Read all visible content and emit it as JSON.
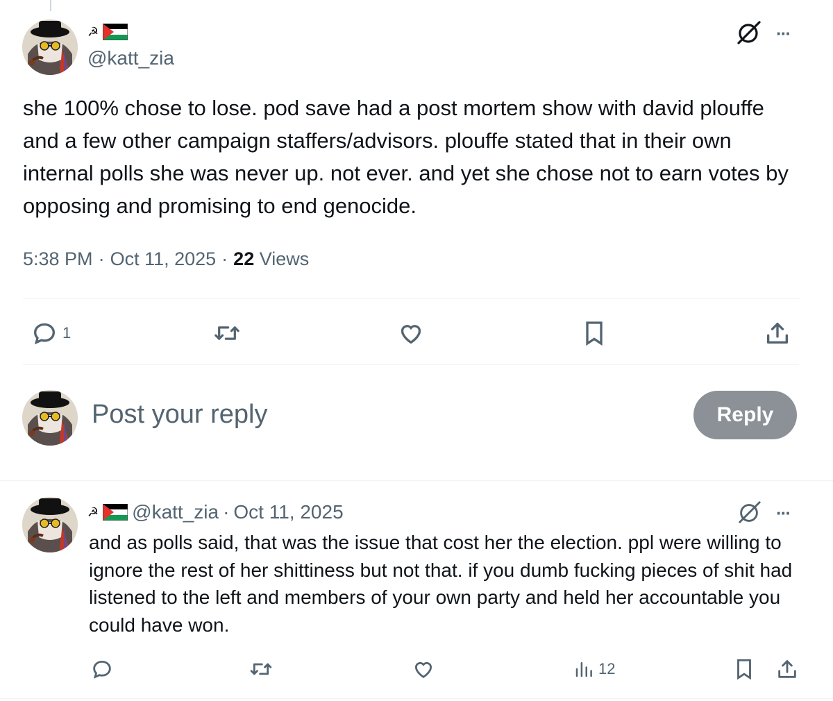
{
  "main_post": {
    "display_name_symbol": "☭",
    "handle": "@katt_zia",
    "text": "she 100% chose to lose. pod save had a post mortem show with david plouffe and a few other campaign staffers/advisors. plouffe stated that in their own internal polls she was never up. not ever. and yet she chose not to earn votes by opposing and promising to end genocide.",
    "time": "5:38 PM",
    "date": "Oct 11, 2025",
    "separator": "·",
    "views_count": "22",
    "views_label": "Views",
    "actions": {
      "reply_count": "1"
    }
  },
  "reply_box": {
    "placeholder": "Post your reply",
    "button_label": "Reply"
  },
  "comment": {
    "display_name_symbol": "☭",
    "handle": "@katt_zia",
    "separator": "·",
    "date": "Oct 11, 2025",
    "text": "and as polls said, that was the issue that cost her the election. ppl were willing to ignore the rest of her shittiness but not that. if you dumb fucking pieces of shit had listened to the left and members of your own party and held her accountable you could have won.",
    "views_count": "12"
  },
  "icons": {
    "more": "more-icon",
    "grok": "grok-icon",
    "reply": "reply-icon",
    "repost": "repost-icon",
    "like": "heart-icon",
    "bookmark": "bookmark-icon",
    "share": "share-icon",
    "analytics": "analytics-icon"
  },
  "colors": {
    "secondary_text": "#536471",
    "primary_text": "#0f1419",
    "reply_button_bg": "#8b9196",
    "divider": "#eff3f4"
  }
}
